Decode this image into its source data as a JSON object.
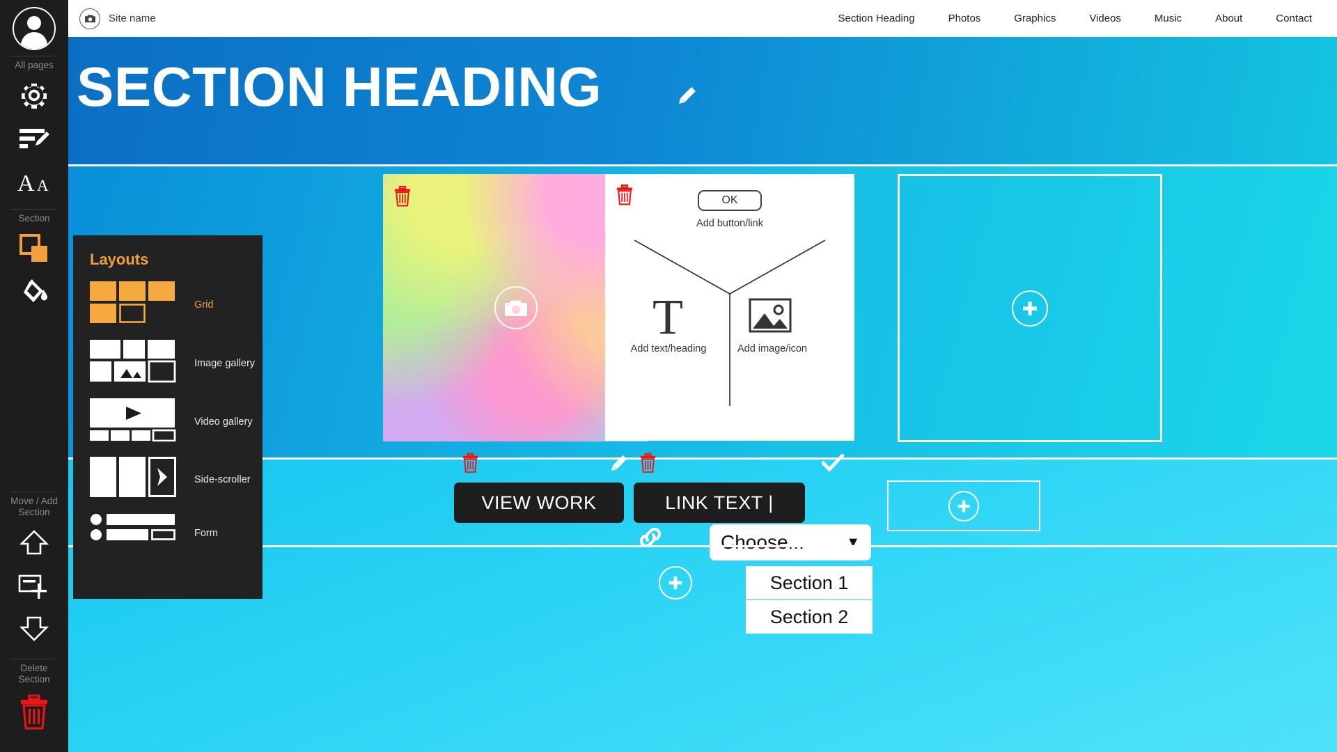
{
  "rail": {
    "avatar": "user-avatar",
    "group_all_pages": "All pages",
    "group_section": "Section",
    "group_move_add": "Move / Add\nSection",
    "move_add_label_line1": "Move / Add",
    "move_add_label_line2": "Section",
    "delete_label_line1": "Delete",
    "delete_label_line2": "Section",
    "icons": [
      "gear-icon",
      "edit-list-icon",
      "typography-icon",
      "section-layers-icon",
      "paint-bucket-icon",
      "arrow-up-icon",
      "add-section-icon",
      "arrow-down-icon",
      "trash-icon"
    ]
  },
  "topnav": {
    "logo_icon": "camera-icon",
    "site_name": "Site name",
    "links": [
      "Section Heading",
      "Photos",
      "Graphics",
      "Videos",
      "Music",
      "About",
      "Contact"
    ]
  },
  "hero": {
    "title": "SECTION HEADING",
    "edit_icon": "pencil-icon"
  },
  "cards": {
    "image_card": {
      "delete_icon": "trash-icon",
      "center_icon": "camera-icon"
    },
    "add_card": {
      "delete_icon": "trash-icon",
      "ok_button": "OK",
      "add_button_link": "Add button/link",
      "add_text_heading": "Add text/heading",
      "add_image_icon": "Add image/icon",
      "text_glyph": "T",
      "image_glyph": "picture-icon"
    },
    "placeholder_card": {
      "add_icon": "plus-circle-icon"
    }
  },
  "bottom": {
    "view_work_label": "VIEW WORK",
    "link_text_label": "LINK TEXT |",
    "view_work_delete_icon": "trash-icon",
    "link_text_delete_icon": "trash-icon",
    "pencil_icon": "pencil-icon",
    "check_icon": "check-icon",
    "link_icon": "link-icon",
    "add_icon": "plus-circle-icon",
    "dropdown": {
      "selected": "Choose...",
      "caret": "▼",
      "options": [
        "Section 1",
        "Section 2"
      ]
    }
  },
  "layouts": {
    "title": "Layouts",
    "items": [
      {
        "label": "Grid",
        "selected": true
      },
      {
        "label": "Image gallery",
        "selected": false
      },
      {
        "label": "Video gallery",
        "selected": false
      },
      {
        "label": "Side-scroller",
        "selected": false
      },
      {
        "label": "Form",
        "selected": false
      }
    ]
  },
  "colors": {
    "rail_bg": "#1d1d1d",
    "accent_orange": "#f0a13c",
    "hero_blue": "#0e86d4",
    "body_cyan": "#17b9e6",
    "danger_red": "#f11414",
    "panel_bg": "#222222"
  }
}
